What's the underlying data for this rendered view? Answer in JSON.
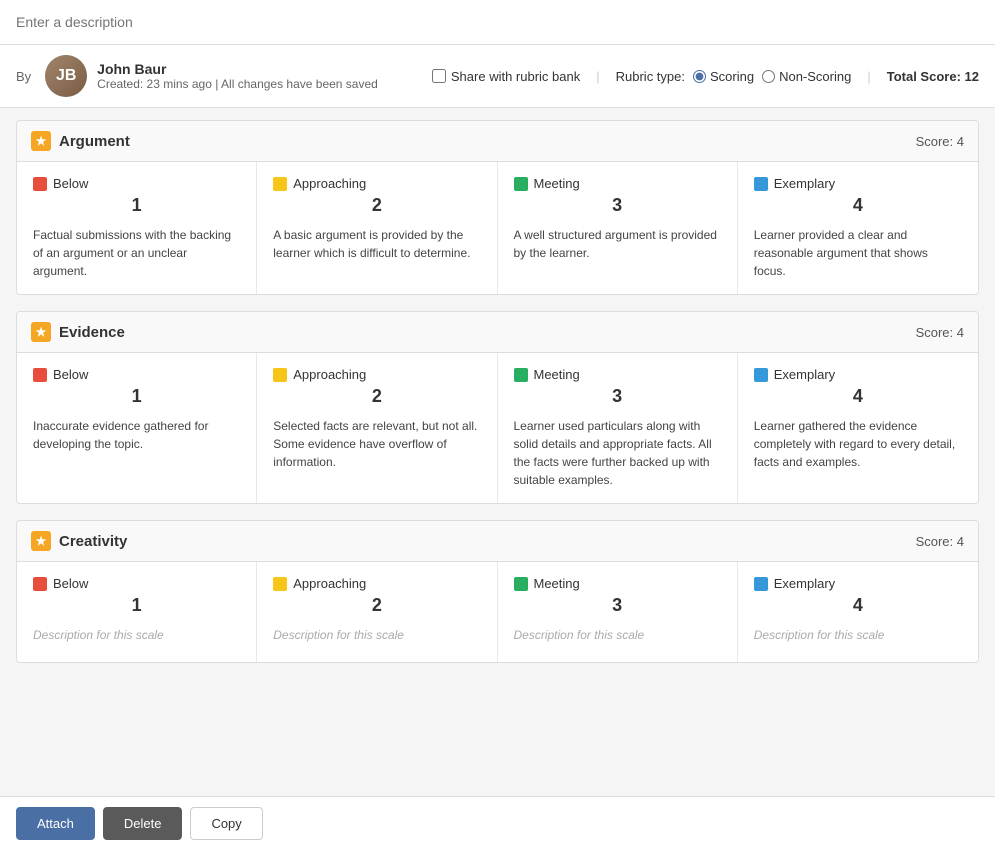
{
  "description": {
    "placeholder": "Enter a description"
  },
  "author": {
    "name": "John Baur",
    "created": "Created: 23 mins ago",
    "separator": "|",
    "saved": "All changes have been saved"
  },
  "controls": {
    "share_label": "Share with rubric bank",
    "rubric_type_label": "Rubric type:",
    "scoring_label": "Scoring",
    "non_scoring_label": "Non-Scoring",
    "total_score_label": "Total Score:",
    "total_score_value": "12"
  },
  "sections": [
    {
      "id": "argument",
      "title": "Argument",
      "score_label": "Score: 4",
      "scales": [
        {
          "color": "#e74c3c",
          "label": "Below",
          "number": "1",
          "description": "Factual submissions with the backing of an argument or an unclear argument.",
          "placeholder": false
        },
        {
          "color": "#f5c518",
          "label": "Approaching",
          "number": "2",
          "description": "A basic argument is provided by the learner which is difficult to determine.",
          "placeholder": false
        },
        {
          "color": "#27ae60",
          "label": "Meeting",
          "number": "3",
          "description": "A well structured argument is provided by the learner.",
          "placeholder": false
        },
        {
          "color": "#3498db",
          "label": "Exemplary",
          "number": "4",
          "description": "Learner provided a clear and reasonable argument that shows focus.",
          "placeholder": false
        }
      ]
    },
    {
      "id": "evidence",
      "title": "Evidence",
      "score_label": "Score: 4",
      "scales": [
        {
          "color": "#e74c3c",
          "label": "Below",
          "number": "1",
          "description": "Inaccurate evidence gathered for developing the topic.",
          "placeholder": false
        },
        {
          "color": "#f5c518",
          "label": "Approaching",
          "number": "2",
          "description": "Selected facts are relevant, but not all. Some evidence have overflow of information.",
          "placeholder": false
        },
        {
          "color": "#27ae60",
          "label": "Meeting",
          "number": "3",
          "description": "Learner used particulars along with solid details and appropriate facts. All the facts were further backed up with suitable examples.",
          "placeholder": false
        },
        {
          "color": "#3498db",
          "label": "Exemplary",
          "number": "4",
          "description": "Learner gathered the evidence completely with regard to every detail, facts and examples.",
          "placeholder": false
        }
      ]
    },
    {
      "id": "creativity",
      "title": "Creativity",
      "score_label": "Score: 4",
      "scales": [
        {
          "color": "#e74c3c",
          "label": "Below",
          "number": "1",
          "description": "Description for this scale",
          "placeholder": true
        },
        {
          "color": "#f5c518",
          "label": "Approaching",
          "number": "2",
          "description": "Description for this scale",
          "placeholder": true
        },
        {
          "color": "#27ae60",
          "label": "Meeting",
          "number": "3",
          "description": "Description for this scale",
          "placeholder": true
        },
        {
          "color": "#3498db",
          "label": "Exemplary",
          "number": "4",
          "description": "Description for this scale",
          "placeholder": true
        }
      ]
    }
  ],
  "footer": {
    "attach_label": "Attach",
    "delete_label": "Delete",
    "copy_label": "Copy"
  }
}
